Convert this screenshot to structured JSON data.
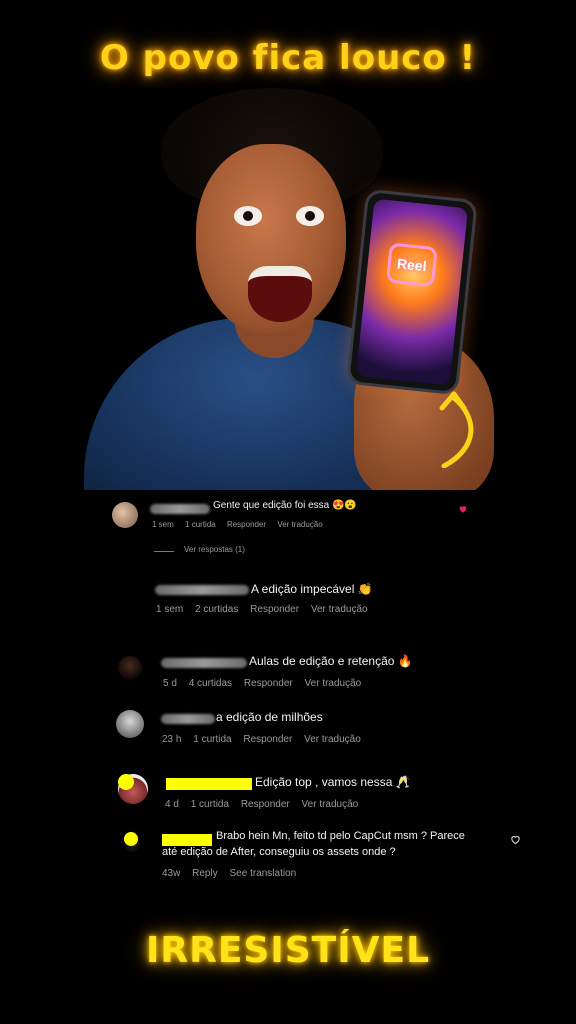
{
  "headline": "O povo fica louco !",
  "phone_label": "Reel",
  "footer": "IRRESISTÍVEL",
  "comments": [
    {
      "text": "Gente que edição foi essa 😍😮",
      "time": "1 sem",
      "likes": "1 curtida",
      "reply": "Responder",
      "translate": "Ver tradução",
      "view_replies": "Ver respostas (1)"
    },
    {
      "text": "A edição impecável 👏",
      "time": "1 sem",
      "likes": "2 curtidas",
      "reply": "Responder",
      "translate": "Ver tradução"
    },
    {
      "text": "Aulas de edição e retenção 🔥",
      "time": "5 d",
      "likes": "4 curtidas",
      "reply": "Responder",
      "translate": "Ver tradução"
    },
    {
      "text": "a edição de milhões",
      "time": "23 h",
      "likes": "1 curtida",
      "reply": "Responder",
      "translate": "Ver tradução"
    },
    {
      "text": "Edição top , vamos nessa 🥂",
      "time": "4 d",
      "likes": "1 curtida",
      "reply": "Responder",
      "translate": "Ver tradução"
    },
    {
      "text_line1": "Brabo hein Mn, feito td pelo CapCut msm ? Parece",
      "text_line2": "até edição de After, conseguiu os assets onde ?",
      "time": "43w",
      "reply": "Reply",
      "translate": "See translation"
    }
  ],
  "colors": {
    "headline": "#ffd21a",
    "footer": "#ffe318",
    "name_highlight": "#ffff00",
    "like_active": "#e0245e"
  }
}
